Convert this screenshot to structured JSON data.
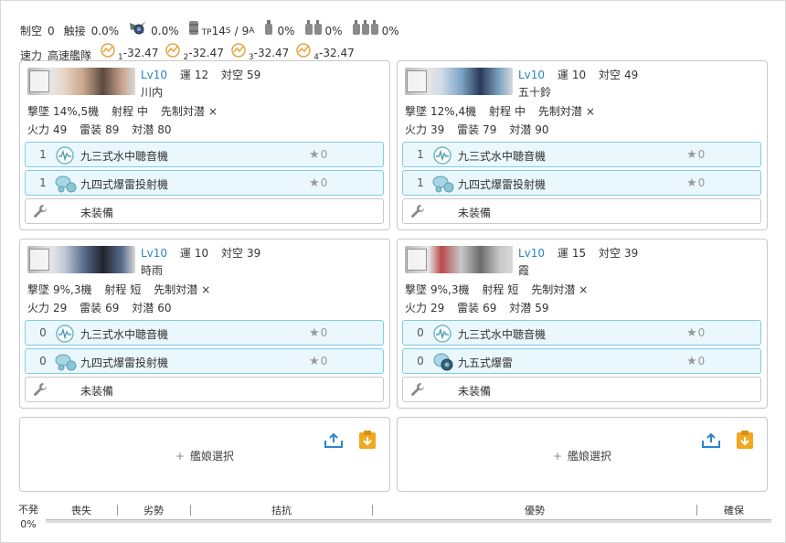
{
  "summary": {
    "air_label": "制空",
    "air_value": "0",
    "contact_label": "触接",
    "contact_value": "0.0%",
    "sortie_value": "0.0%",
    "tp_label": "TP",
    "tp_s": "14",
    "tp_s_sub": "S",
    "tp_sep": "/",
    "tp_a": "9",
    "tp_a_sub": "A",
    "drum1_value": "0%",
    "drum2_value": "0%",
    "drum3_value": "0%",
    "speed_label": "速力",
    "speed_value": "高速艦隊",
    "los": [
      {
        "sub": "1",
        "value": "-32.47"
      },
      {
        "sub": "2",
        "value": "-32.47"
      },
      {
        "sub": "3",
        "value": "-32.47"
      },
      {
        "sub": "4",
        "value": "-32.47"
      }
    ]
  },
  "ships": [
    {
      "lv": "Lv10",
      "luck_label": "運",
      "luck": "12",
      "aa_label": "対空",
      "aa": "59",
      "name": "川内",
      "shotdown_label": "撃墜",
      "shotdown": "14%,5機",
      "range_label": "射程",
      "range": "中",
      "oasw_label": "先制対潜",
      "oasw": "×",
      "fp_label": "火力",
      "fp": "49",
      "tp_label": "雷装",
      "tp": "89",
      "asw_label": "対潜",
      "asw": "80",
      "equips": [
        {
          "count": "1",
          "name": "九三式水中聴音機",
          "star": "0",
          "icon": "sonar-icon"
        },
        {
          "count": "1",
          "name": "九四式爆雷投射機",
          "star": "0",
          "icon": "depth-charge-projector-icon"
        }
      ],
      "empty_label": "未装備",
      "banner_colors": [
        "#5a4a3f",
        "#c9a58c",
        "#e7d6c8"
      ]
    },
    {
      "lv": "Lv10",
      "luck_label": "運",
      "luck": "10",
      "aa_label": "対空",
      "aa": "49",
      "name": "五十鈴",
      "shotdown_label": "撃墜",
      "shotdown": "12%,4機",
      "range_label": "射程",
      "range": "中",
      "oasw_label": "先制対潜",
      "oasw": "×",
      "fp_label": "火力",
      "fp": "39",
      "tp_label": "雷装",
      "tp": "79",
      "asw_label": "対潜",
      "asw": "90",
      "equips": [
        {
          "count": "1",
          "name": "九三式水中聴音機",
          "star": "0",
          "icon": "sonar-icon"
        },
        {
          "count": "1",
          "name": "九四式爆雷投射機",
          "star": "0",
          "icon": "depth-charge-projector-icon"
        }
      ],
      "empty_label": "未装備",
      "banner_colors": [
        "#2a3a58",
        "#7fa6c7",
        "#d0dbe8"
      ]
    },
    {
      "lv": "Lv10",
      "luck_label": "運",
      "luck": "10",
      "aa_label": "対空",
      "aa": "39",
      "name": "時雨",
      "shotdown_label": "撃墜",
      "shotdown": "9%,3機",
      "range_label": "射程",
      "range": "短",
      "oasw_label": "先制対潜",
      "oasw": "×",
      "fp_label": "火力",
      "fp": "29",
      "tp_label": "雷装",
      "tp": "69",
      "asw_label": "対潜",
      "asw": "60",
      "equips": [
        {
          "count": "0",
          "name": "九三式水中聴音機",
          "star": "0",
          "icon": "sonar-icon"
        },
        {
          "count": "0",
          "name": "九四式爆雷投射機",
          "star": "0",
          "icon": "depth-charge-projector-icon"
        }
      ],
      "empty_label": "未装備",
      "banner_colors": [
        "#22222e",
        "#5b6f8f",
        "#c4cbd8"
      ]
    },
    {
      "lv": "Lv10",
      "luck_label": "運",
      "luck": "15",
      "aa_label": "対空",
      "aa": "39",
      "name": "霞",
      "shotdown_label": "撃墜",
      "shotdown": "9%,3機",
      "range_label": "射程",
      "range": "短",
      "oasw_label": "先制対潜",
      "oasw": "×",
      "fp_label": "火力",
      "fp": "29",
      "tp_label": "雷装",
      "tp": "69",
      "asw_label": "対潜",
      "asw": "59",
      "equips": [
        {
          "count": "0",
          "name": "九三式水中聴音機",
          "star": "0",
          "icon": "sonar-icon"
        },
        {
          "count": "0",
          "name": "九五式爆雷",
          "star": "0",
          "icon": "depth-charge-icon"
        }
      ],
      "empty_label": "未装備",
      "banner_colors": [
        "#6c6c6c",
        "#c8c8c8",
        "#b84a4a"
      ]
    }
  ],
  "add_ship": {
    "label": "艦娘選択",
    "plus": "+"
  },
  "gauge": {
    "no_trigger_label": "不発",
    "no_trigger_value": "0%",
    "segments": [
      "喪失",
      "劣勢",
      "拮抗",
      "優勢",
      "確保"
    ]
  },
  "colors": {
    "accent": "#2a85c6",
    "equip_border": "#7fcde0",
    "equip_bg": "#eaf7fc",
    "clipboard": "#f0a91e"
  }
}
